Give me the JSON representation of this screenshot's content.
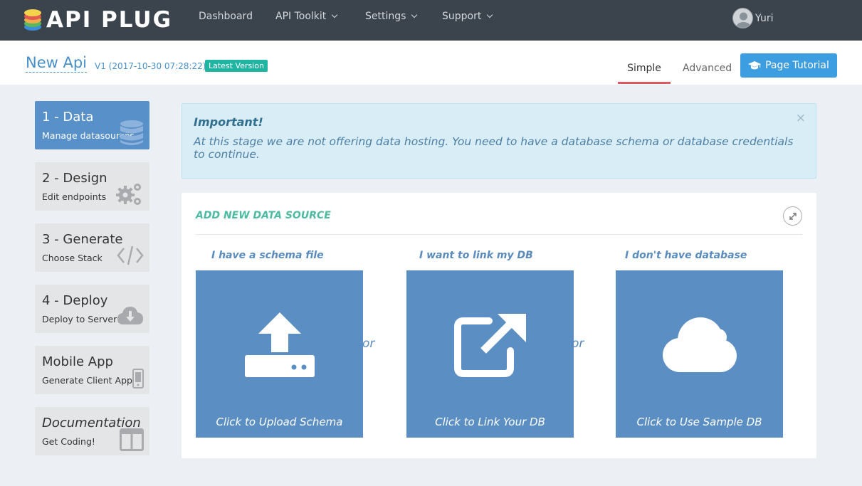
{
  "brand": {
    "name": "API PLUG"
  },
  "nav": {
    "dashboard": "Dashboard",
    "toolkit": "API Toolkit",
    "settings": "Settings",
    "support": "Support"
  },
  "user": {
    "name": "Yuri",
    "icon": "user-avatar-icon"
  },
  "header": {
    "title": "New Api",
    "version": "V1 (2017-10-30 07:28:22)",
    "badge": "Latest Version",
    "tabs": {
      "simple": "Simple",
      "advanced": "Advanced"
    },
    "active_tab": "Simple",
    "tutorial_button": "Page Tutorial",
    "tutorial_icon": "graduation-cap-icon"
  },
  "steps": [
    {
      "title": "1 - Data",
      "subtitle": "Manage datasources",
      "icon": "database-icon",
      "active": true
    },
    {
      "title": "2 - Design",
      "subtitle": "Edit endpoints",
      "icon": "gears-icon",
      "active": false
    },
    {
      "title": "3 - Generate",
      "subtitle": "Choose Stack",
      "icon": "code-icon",
      "active": false
    },
    {
      "title": "4 - Deploy",
      "subtitle": "Deploy to Server",
      "icon": "cloud-download-icon",
      "active": false
    },
    {
      "title": "Mobile App",
      "subtitle": "Generate Client App",
      "icon": "mobile-icon",
      "active": false
    },
    {
      "title": "Documentation",
      "subtitle": "Get Coding!",
      "icon": "book-icon",
      "active": false
    }
  ],
  "alert": {
    "title": "Important!",
    "message": "At this stage we are not offering data hosting. You need to have a database schema or database credentials to continue.",
    "close": "×"
  },
  "panel": {
    "title": "ADD NEW DATA SOURCE",
    "separator": "or",
    "options": [
      {
        "label": "I have a schema file",
        "caption": "Click to Upload Schema",
        "icon": "upload-icon"
      },
      {
        "label": "I want to link my DB",
        "caption": "Click to Link Your DB",
        "icon": "external-link-icon"
      },
      {
        "label": "I don't have database",
        "caption": "Click to Use Sample DB",
        "icon": "cloud-icon"
      }
    ]
  },
  "colors": {
    "topbar": "#3b434c",
    "accent": "#3c9de0",
    "active_step": "#5890c9",
    "tile": "#5b8ec3",
    "badge": "#1fb5a2",
    "tab_underline": "#e2575d",
    "panel_title": "#4dbaa2"
  }
}
